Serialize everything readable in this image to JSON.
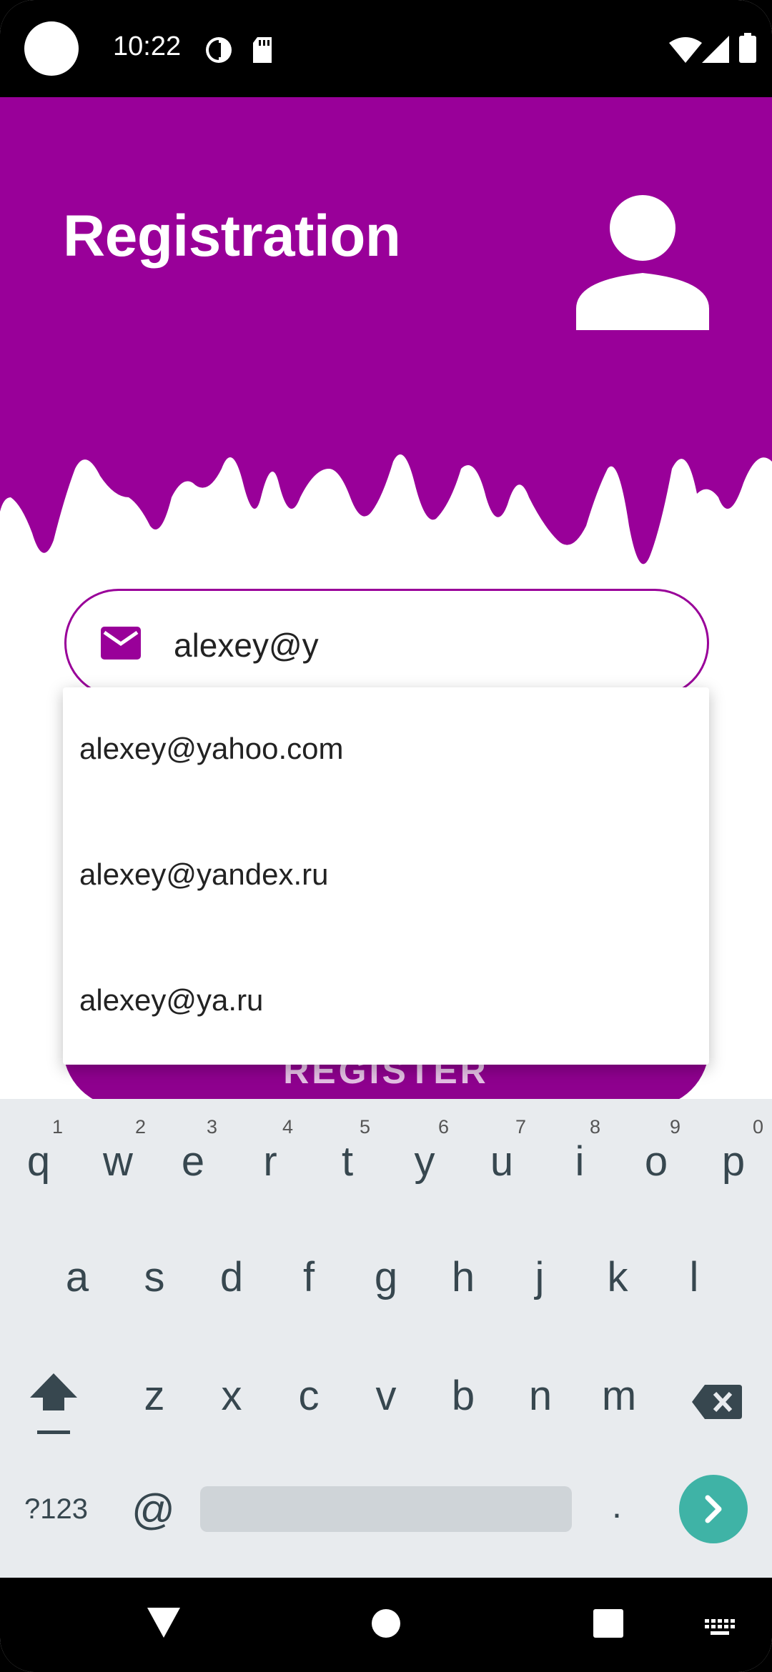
{
  "status_bar": {
    "time": "10:22",
    "icons": [
      "camera-cutout",
      "data-saver-icon",
      "sd-card-icon",
      "wifi-icon",
      "signal-icon",
      "battery-icon"
    ]
  },
  "header": {
    "title": "Registration",
    "background_color": "#990099",
    "avatar_icon": "person-icon"
  },
  "email_field": {
    "icon": "mail-icon",
    "value": "alexey@y",
    "accent_color": "#990099"
  },
  "suggestions": [
    "alexey@yahoo.com",
    "alexey@yandex.ru",
    "alexey@ya.ru"
  ],
  "register_button": {
    "label": "REGISTER"
  },
  "keyboard": {
    "row1": [
      {
        "key": "q",
        "hint": "1"
      },
      {
        "key": "w",
        "hint": "2"
      },
      {
        "key": "e",
        "hint": "3"
      },
      {
        "key": "r",
        "hint": "4"
      },
      {
        "key": "t",
        "hint": "5"
      },
      {
        "key": "y",
        "hint": "6"
      },
      {
        "key": "u",
        "hint": "7"
      },
      {
        "key": "i",
        "hint": "8"
      },
      {
        "key": "o",
        "hint": "9"
      },
      {
        "key": "p",
        "hint": "0"
      }
    ],
    "row2": [
      "a",
      "s",
      "d",
      "f",
      "g",
      "h",
      "j",
      "k",
      "l"
    ],
    "row3": [
      "z",
      "x",
      "c",
      "v",
      "b",
      "n",
      "m"
    ],
    "symbols_label": "?123",
    "at_label": "@",
    "period_label": ".",
    "enter_color": "#3fb3a6"
  }
}
